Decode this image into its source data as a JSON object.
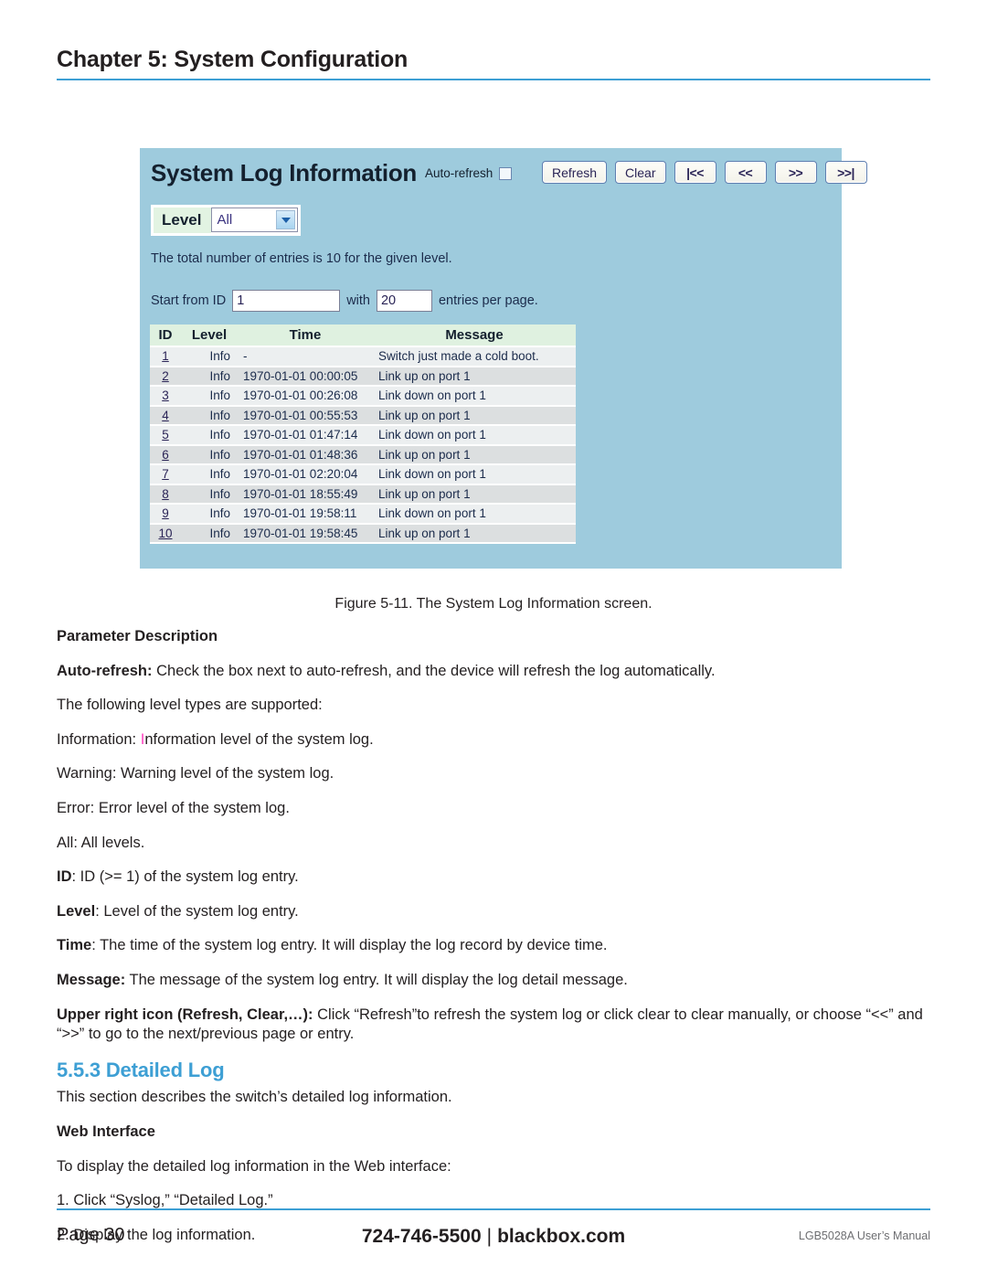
{
  "header": {
    "chapter_title": "Chapter 5: System Configuration",
    "rule_color": "#3d9fd4"
  },
  "screenshot": {
    "panel_bg": "#9ecbdd",
    "title": "System Log Information",
    "auto_refresh_label": "Auto-refresh",
    "auto_refresh_checked": false,
    "buttons": [
      {
        "name": "refresh",
        "label": "Refresh"
      },
      {
        "name": "clear",
        "label": "Clear"
      },
      {
        "name": "first-page",
        "label": "|<<"
      },
      {
        "name": "prev-page",
        "label": "<<"
      },
      {
        "name": "next-page",
        "label": ">>"
      },
      {
        "name": "last-page",
        "label": ">>|"
      }
    ],
    "level": {
      "label": "Level",
      "selected": "All",
      "options": [
        "All",
        "Information",
        "Warning",
        "Error"
      ]
    },
    "entries_note": "The total number of entries is 10 for the given level.",
    "paging": {
      "start_label": "Start from ID",
      "start_value": "1",
      "with_label": "with",
      "per_page_value": "20",
      "per_page_suffix": "entries per page."
    },
    "table": {
      "columns": [
        "ID",
        "Level",
        "Time",
        "Message"
      ],
      "rows": [
        {
          "id": "1",
          "level": "Info",
          "time": "-",
          "message": "Switch just made a cold boot."
        },
        {
          "id": "2",
          "level": "Info",
          "time": "1970-01-01 00:00:05",
          "message": "Link up on port 1"
        },
        {
          "id": "3",
          "level": "Info",
          "time": "1970-01-01 00:26:08",
          "message": "Link down on port 1"
        },
        {
          "id": "4",
          "level": "Info",
          "time": "1970-01-01 00:55:53",
          "message": "Link up on port 1"
        },
        {
          "id": "5",
          "level": "Info",
          "time": "1970-01-01 01:47:14",
          "message": "Link down on port 1"
        },
        {
          "id": "6",
          "level": "Info",
          "time": "1970-01-01 01:48:36",
          "message": "Link up on port 1"
        },
        {
          "id": "7",
          "level": "Info",
          "time": "1970-01-01 02:20:04",
          "message": "Link down on port 1"
        },
        {
          "id": "8",
          "level": "Info",
          "time": "1970-01-01 18:55:49",
          "message": "Link up on port 1"
        },
        {
          "id": "9",
          "level": "Info",
          "time": "1970-01-01 19:58:11",
          "message": "Link down on port 1"
        },
        {
          "id": "10",
          "level": "Info",
          "time": "1970-01-01 19:58:45",
          "message": "Link up on port 1"
        }
      ]
    }
  },
  "figure_caption": "Figure 5-11. The System Log Information screen.",
  "body": {
    "parameter_description_heading": "Parameter Description",
    "auto_refresh_term": "Auto-refresh:",
    "auto_refresh_text": " Check the box next to auto-refresh, and the device will refresh the log automatically.",
    "level_types_intro": "The following level types are supported:",
    "information_prefix": "Information: ",
    "information_pink_letter": "I",
    "information_rest": "nformation level of the system log.",
    "warning_line": "Warning: Warning level of the system log.",
    "error_line": "Error: Error level of the system log.",
    "all_line": "All: All levels.",
    "id_term": "ID",
    "id_text": ": ID (>= 1) of the system log entry.",
    "level_term": "Level",
    "level_text": ": Level of the system log entry.",
    "time_term": "Time",
    "time_text": ": The time of the system log entry. It will display the log record by device time.",
    "message_term": "Message:",
    "message_text": " The message of the system log entry. It will display the log detail message.",
    "upper_right_term": "Upper right icon (Refresh, Clear,…):",
    "upper_right_text": " Click “Refresh”to refresh the system log or click clear to clear manually, or choose “<<” and “>>” to go to the next/previous page or entry."
  },
  "section": {
    "number_title": "5.5.3 Detailed Log",
    "intro": "This section describes the switch’s detailed log information.",
    "web_interface_heading": "Web Interface",
    "web_interface_intro": "To display the detailed log information in the Web interface:",
    "step1": "1. Click “Syslog,” “Detailed Log.”",
    "step2": "2. Display the log information."
  },
  "footer": {
    "page_label": "Page 30",
    "phone": "724-746-5500",
    "separator": "|",
    "site": "blackbox.com",
    "manual": "LGB5028A User’s Manual"
  }
}
